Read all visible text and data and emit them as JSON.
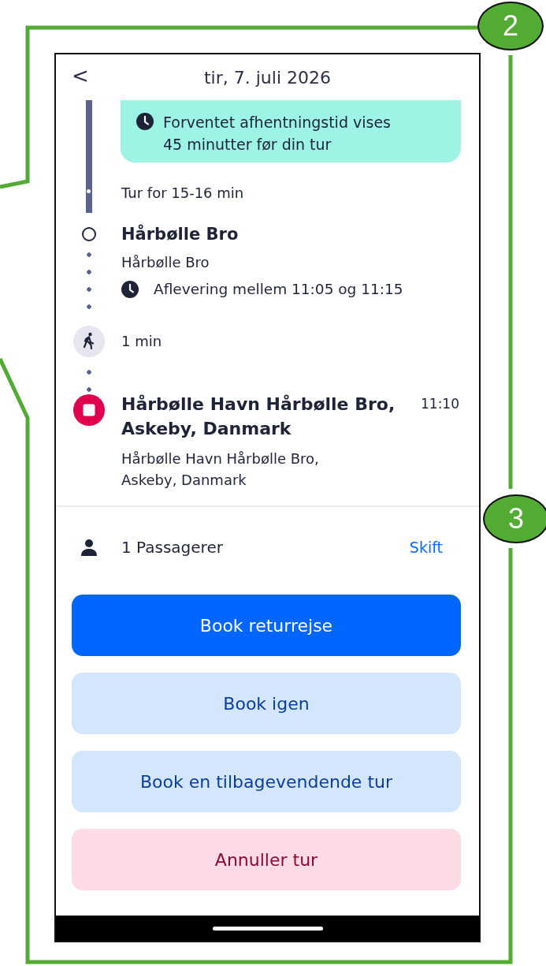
{
  "header": {
    "back": "<",
    "title": "tir, 7. juli 2026"
  },
  "timeline": [
    {
      "kind": "notice",
      "lines": [
        "Forventet afhentningstid vises",
        "45 minutter før din tur"
      ]
    },
    {
      "kind": "duration",
      "text": "Tur for 15-16 min"
    },
    {
      "kind": "stop",
      "title": "Hårbølle Bro",
      "subtitle": "Hårbølle Bro",
      "info": "Aflevering mellem 11:05 og 11:15"
    },
    {
      "kind": "walk",
      "text": "1 min"
    },
    {
      "kind": "destination",
      "title": "Hårbølle Havn Hårbølle Bro, Askeby, Danmark",
      "time": "11:10",
      "subtitle": "Hårbølle Havn Hårbølle Bro, Askeby, Danmark"
    }
  ],
  "passengers": {
    "label": "1 Passagerer",
    "action": "Skift"
  },
  "buttons": [
    {
      "kind": "primary",
      "label": "Book returrejse"
    },
    {
      "kind": "secondary",
      "label": "Book igen"
    },
    {
      "kind": "secondary",
      "label": "Book en tilbagevendende tur"
    },
    {
      "kind": "danger",
      "label": "Annuller tur"
    }
  ],
  "annotations": [
    {
      "label": "2"
    },
    {
      "label": "3"
    }
  ]
}
